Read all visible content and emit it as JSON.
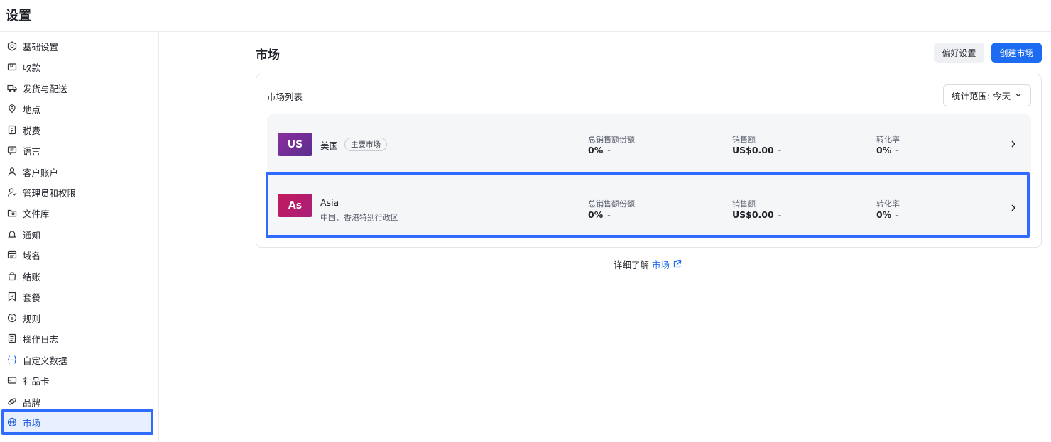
{
  "header": {
    "title": "设置"
  },
  "sidebar": {
    "items": [
      {
        "label": "基础设置",
        "icon": "settings-hex-icon"
      },
      {
        "label": "收款",
        "icon": "wallet-icon"
      },
      {
        "label": "发货与配送",
        "icon": "truck-icon"
      },
      {
        "label": "地点",
        "icon": "location-pin-icon"
      },
      {
        "label": "税费",
        "icon": "tax-receipt-icon"
      },
      {
        "label": "语言",
        "icon": "language-icon"
      },
      {
        "label": "客户账户",
        "icon": "user-icon"
      },
      {
        "label": "管理员和权限",
        "icon": "admin-user-icon"
      },
      {
        "label": "文件库",
        "icon": "folder-icon"
      },
      {
        "label": "通知",
        "icon": "bell-icon"
      },
      {
        "label": "域名",
        "icon": "domain-icon"
      },
      {
        "label": "结账",
        "icon": "shopping-bag-icon"
      },
      {
        "label": "套餐",
        "icon": "plan-icon"
      },
      {
        "label": "规则",
        "icon": "info-circle-icon"
      },
      {
        "label": "操作日志",
        "icon": "log-icon"
      },
      {
        "label": "自定义数据",
        "icon": "custom-data-icon"
      },
      {
        "label": "礼品卡",
        "icon": "gift-card-icon"
      },
      {
        "label": "品牌",
        "icon": "brand-icon"
      },
      {
        "label": "市场",
        "icon": "globe-icon",
        "active": true
      }
    ]
  },
  "main": {
    "title": "市场",
    "preferences_label": "偏好设置",
    "create_label": "创建市场",
    "card_title": "市场列表",
    "range_label": "统计范围: 今天",
    "markets": [
      {
        "code": "US",
        "name": "美国",
        "tag": "主要市场",
        "subtitle": "",
        "share_label": "总销售额份额",
        "share_value": "0%",
        "sales_label": "销售额",
        "sales_value": "US$0.00",
        "conv_label": "转化率",
        "conv_value": "0%",
        "dash": "-"
      },
      {
        "code": "As",
        "name": "Asia",
        "tag": "",
        "subtitle": "中国、香港特别行政区",
        "share_label": "总销售额份额",
        "share_value": "0%",
        "sales_label": "销售额",
        "sales_value": "US$0.00",
        "conv_label": "转化率",
        "conv_value": "0%",
        "dash": "-"
      }
    ],
    "footer_text": "详细了解",
    "footer_link": "市场"
  },
  "colors": {
    "accent": "#1d6bf0",
    "highlight": "#2f6bff"
  }
}
